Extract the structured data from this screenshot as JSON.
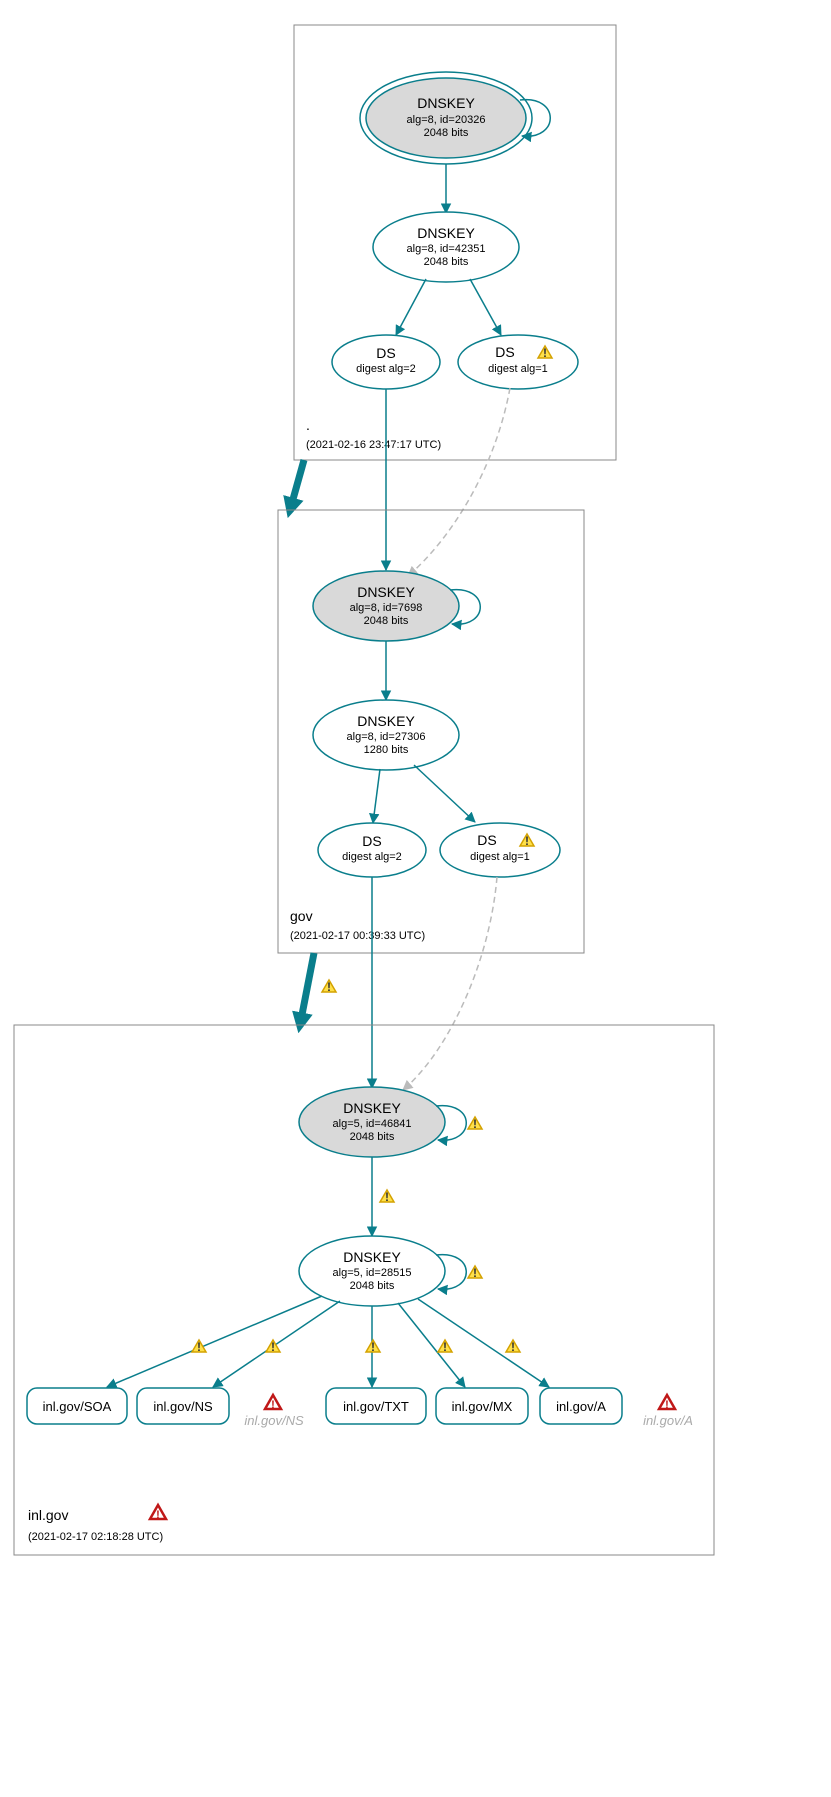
{
  "zones": [
    {
      "name": ".",
      "ts": "(2021-02-16 23:47:17 UTC)"
    },
    {
      "name": "gov",
      "ts": "(2021-02-17 00:39:33 UTC)"
    },
    {
      "name": "inl.gov",
      "ts": "(2021-02-17 02:18:28 UTC)"
    }
  ],
  "nodes": {
    "root_ksk": {
      "title": "DNSKEY",
      "l1": "alg=8, id=20326",
      "l2": "2048 bits"
    },
    "root_zsk": {
      "title": "DNSKEY",
      "l1": "alg=8, id=42351",
      "l2": "2048 bits"
    },
    "root_ds2": {
      "title": "DS",
      "l1": "digest alg=2"
    },
    "root_ds1": {
      "title": "DS",
      "l1": "digest alg=1"
    },
    "gov_ksk": {
      "title": "DNSKEY",
      "l1": "alg=8, id=7698",
      "l2": "2048 bits"
    },
    "gov_zsk": {
      "title": "DNSKEY",
      "l1": "alg=8, id=27306",
      "l2": "1280 bits"
    },
    "gov_ds2": {
      "title": "DS",
      "l1": "digest alg=2"
    },
    "gov_ds1": {
      "title": "DS",
      "l1": "digest alg=1"
    },
    "inl_ksk": {
      "title": "DNSKEY",
      "l1": "alg=5, id=46841",
      "l2": "2048 bits"
    },
    "inl_zsk": {
      "title": "DNSKEY",
      "l1": "alg=5, id=28515",
      "l2": "2048 bits"
    }
  },
  "rrsets": {
    "soa": "inl.gov/SOA",
    "ns": "inl.gov/NS",
    "txt": "inl.gov/TXT",
    "mx": "inl.gov/MX",
    "a": "inl.gov/A"
  },
  "ghosts": {
    "ns": "inl.gov/NS",
    "a": "inl.gov/A"
  }
}
